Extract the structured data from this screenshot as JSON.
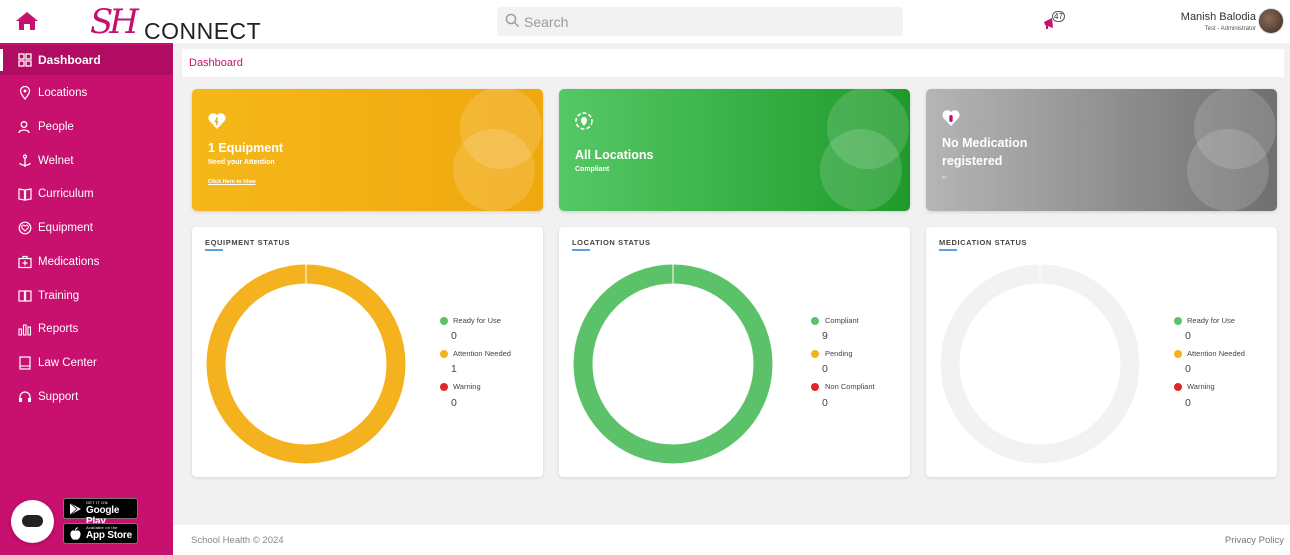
{
  "header": {
    "logo_sh": "SH",
    "logo_connect": "CONNECT",
    "search_placeholder": "Search",
    "notification_count": "47",
    "user_name": "Manish Balodia",
    "user_role": "Test - Administrator"
  },
  "sidebar": {
    "items": [
      {
        "label": "Dashboard",
        "icon": "grid-icon",
        "active": true
      },
      {
        "label": "Locations",
        "icon": "location-pin-icon"
      },
      {
        "label": "People",
        "icon": "people-icon"
      },
      {
        "label": "Welnet",
        "icon": "anchor-icon"
      },
      {
        "label": "Curriculum",
        "icon": "book-icon"
      },
      {
        "label": "Equipment",
        "icon": "heart-shield-icon"
      },
      {
        "label": "Medications",
        "icon": "medical-kit-icon"
      },
      {
        "label": "Training",
        "icon": "training-book-icon"
      },
      {
        "label": "Reports",
        "icon": "bar-chart-icon"
      },
      {
        "label": "Law Center",
        "icon": "law-book-icon"
      },
      {
        "label": "Support",
        "icon": "headset-icon"
      }
    ],
    "google_play_small": "GET IT ON",
    "google_play_big": "Google Play",
    "app_store_small": "Available on the",
    "app_store_big": "App Store"
  },
  "breadcrumb": "Dashboard",
  "cards": {
    "equipment": {
      "title": "1 Equipment",
      "subtitle": "Need your Attention",
      "link": "Click Here to View",
      "color": "#f5b719"
    },
    "locations": {
      "title": "All Locations",
      "subtitle": "Compliant",
      "color": "#3cb54a"
    },
    "medication": {
      "title_line1": "No Medication",
      "title_line2": "registered",
      "subtitle": "--",
      "color": "#9a9a9a"
    }
  },
  "panels": {
    "equipment": {
      "title": "EQUIPMENT STATUS",
      "legend": [
        {
          "label": "Ready for Use",
          "value": "0",
          "color": "#5cc26a"
        },
        {
          "label": "Attention Needed",
          "value": "1",
          "color": "#f4b21e"
        },
        {
          "label": "Warning",
          "value": "0",
          "color": "#e0262a"
        }
      ],
      "ring_color": "#f4b21e"
    },
    "location": {
      "title": "LOCATION STATUS",
      "legend": [
        {
          "label": "Compliant",
          "value": "9",
          "color": "#5cc26a"
        },
        {
          "label": "Pending",
          "value": "0",
          "color": "#f4b21e"
        },
        {
          "label": "Non Compliant",
          "value": "0",
          "color": "#e0262a"
        }
      ],
      "ring_color": "#5cc26a"
    },
    "medication": {
      "title": "MEDICATION STATUS",
      "legend": [
        {
          "label": "Ready for Use",
          "value": "0",
          "color": "#5cc26a"
        },
        {
          "label": "Attention Needed",
          "value": "0",
          "color": "#f4b21e"
        },
        {
          "label": "Warning",
          "value": "0",
          "color": "#e0262a"
        }
      ],
      "ring_color": "#f2f2f2"
    }
  },
  "footer": {
    "copyright": "School Health © 2024",
    "privacy": "Privacy Policy"
  }
}
